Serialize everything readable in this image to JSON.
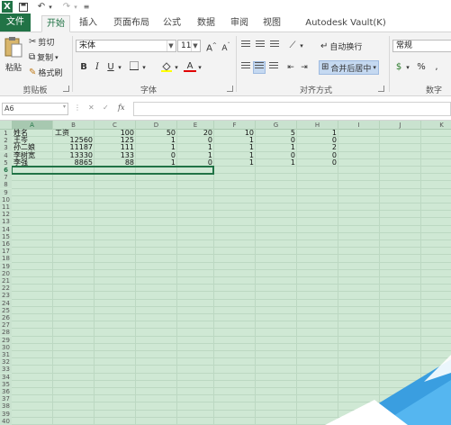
{
  "app": {
    "title": "Excel"
  },
  "ribbon_tabs": [
    {
      "label": "文件"
    },
    {
      "label": "开始"
    },
    {
      "label": "插入"
    },
    {
      "label": "页面布局"
    },
    {
      "label": "公式"
    },
    {
      "label": "数据"
    },
    {
      "label": "审阅"
    },
    {
      "label": "视图"
    },
    {
      "label": "Autodesk Vault(K)"
    }
  ],
  "clipboard": {
    "paste": "粘贴",
    "cut": "剪切",
    "copy": "复制",
    "format_painter": "格式刷",
    "label": "剪贴板"
  },
  "font": {
    "name": "宋体",
    "size": "11",
    "label": "字体"
  },
  "alignment": {
    "wrap_text": "自动换行",
    "merge_center": "合并后居中",
    "label": "对齐方式"
  },
  "number": {
    "format": "常规",
    "label": "数字"
  },
  "formula_bar": {
    "name_box": "A6",
    "fx": "fx",
    "value": ""
  },
  "columns": [
    "A",
    "B",
    "C",
    "D",
    "E",
    "F",
    "G",
    "H",
    "I",
    "J",
    "K"
  ],
  "rows": [
    "1",
    "2",
    "3",
    "4",
    "5",
    "6",
    "7",
    "8",
    "9",
    "10",
    "11",
    "12",
    "13",
    "14",
    "15",
    "16",
    "17",
    "18",
    "19",
    "20",
    "21",
    "22",
    "23",
    "24",
    "25",
    "26",
    "27",
    "28",
    "29",
    "30",
    "31",
    "32",
    "33",
    "34",
    "35",
    "36",
    "37",
    "38",
    "39",
    "40"
  ],
  "selected_cell": "A6",
  "sheet": [
    [
      "姓名",
      "工资",
      "100",
      "50",
      "20",
      "10",
      "5",
      "1"
    ],
    [
      "王岑",
      "12560",
      "125",
      "1",
      "0",
      "1",
      "0",
      "0"
    ],
    [
      "孙二娘",
      "11187",
      "111",
      "1",
      "1",
      "1",
      "1",
      "2"
    ],
    [
      "李树宽",
      "13330",
      "133",
      "0",
      "1",
      "1",
      "0",
      "0"
    ],
    [
      "李强",
      "8865",
      "88",
      "1",
      "0",
      "1",
      "1",
      "0"
    ]
  ],
  "colors": {
    "excel_green": "#217346",
    "sheet_bg": "#cfe8d4"
  }
}
